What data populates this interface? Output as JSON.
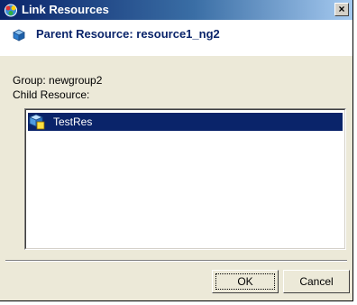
{
  "window": {
    "title": "Link Resources",
    "close_label": "×"
  },
  "header": {
    "title": "Parent Resource: resource1_ng2"
  },
  "body": {
    "group_text": "Group: newgroup2",
    "child_label": "Child Resource:"
  },
  "child_resources": [
    {
      "label": "TestRes",
      "selected": true
    }
  ],
  "buttons": {
    "ok": "OK",
    "cancel": "Cancel"
  },
  "colors": {
    "title_bar": "#0a246a",
    "selection": "#0a246a",
    "header_text": "#0a246a",
    "dialog_bg": "#ece9d8"
  }
}
